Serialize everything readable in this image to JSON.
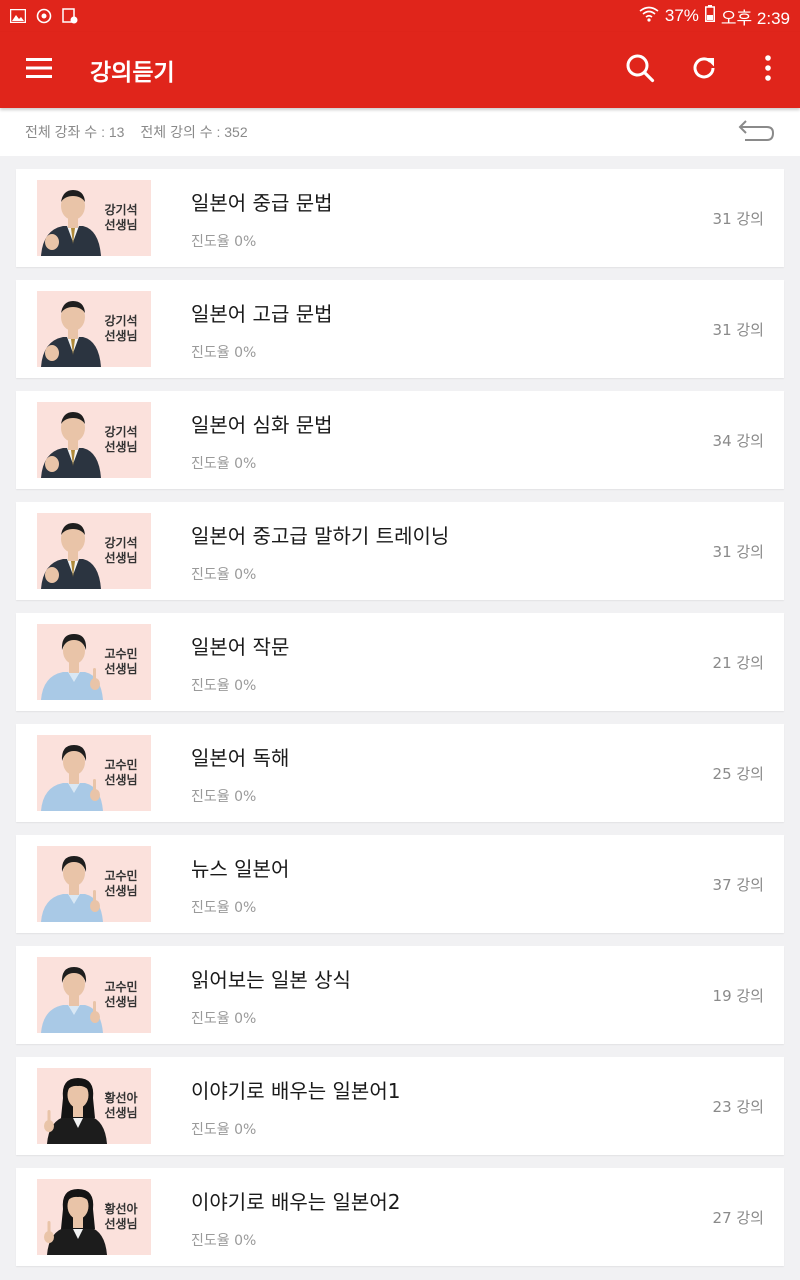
{
  "status_bar": {
    "battery": "37%",
    "time": "오후 2:39"
  },
  "app_bar": {
    "title": "강의듣기"
  },
  "summary": {
    "total_courses": "전체 강좌 수 : 13",
    "total_lectures": "전체 강의 수 : 352"
  },
  "courses": [
    {
      "teacher": "강기석\n선생님",
      "teacher_style": "man",
      "title": "일본어 중급 문법",
      "progress": "진도율 0%",
      "count": "31 강의"
    },
    {
      "teacher": "강기석\n선생님",
      "teacher_style": "man",
      "title": "일본어 고급 문법",
      "progress": "진도율 0%",
      "count": "31 강의"
    },
    {
      "teacher": "강기석\n선생님",
      "teacher_style": "man",
      "title": "일본어 심화 문법",
      "progress": "진도율 0%",
      "count": "34 강의"
    },
    {
      "teacher": "강기석\n선생님",
      "teacher_style": "man",
      "title": "일본어 중고급 말하기 트레이닝",
      "progress": "진도율 0%",
      "count": "31 강의"
    },
    {
      "teacher": "고수민\n선생님",
      "teacher_style": "woman-blue",
      "title": "일본어 작문",
      "progress": "진도율 0%",
      "count": "21 강의"
    },
    {
      "teacher": "고수민\n선생님",
      "teacher_style": "woman-blue",
      "title": "일본어 독해",
      "progress": "진도율 0%",
      "count": "25 강의"
    },
    {
      "teacher": "고수민\n선생님",
      "teacher_style": "woman-blue",
      "title": "뉴스 일본어",
      "progress": "진도율 0%",
      "count": "37 강의"
    },
    {
      "teacher": "고수민\n선생님",
      "teacher_style": "woman-blue",
      "title": "읽어보는 일본 상식",
      "progress": "진도율 0%",
      "count": "19 강의"
    },
    {
      "teacher": "황선아\n선생님",
      "teacher_style": "woman-black",
      "title": "이야기로 배우는 일본어1",
      "progress": "진도율 0%",
      "count": "23 강의"
    },
    {
      "teacher": "황선아\n선생님",
      "teacher_style": "woman-black",
      "title": "이야기로 배우는 일본어2",
      "progress": "진도율 0%",
      "count": "27 강의"
    }
  ],
  "icons": {
    "status_left": [
      "image-icon",
      "sync-icon",
      "download-icon"
    ],
    "app_bar": [
      "menu-icon",
      "search-icon",
      "refresh-icon",
      "more-vert-icon"
    ],
    "summary": [
      "back-arrow-icon"
    ]
  },
  "colors": {
    "primary": "#e0251b",
    "thumb_bg": "#fbe1dc",
    "background": "#f1f1f3"
  }
}
